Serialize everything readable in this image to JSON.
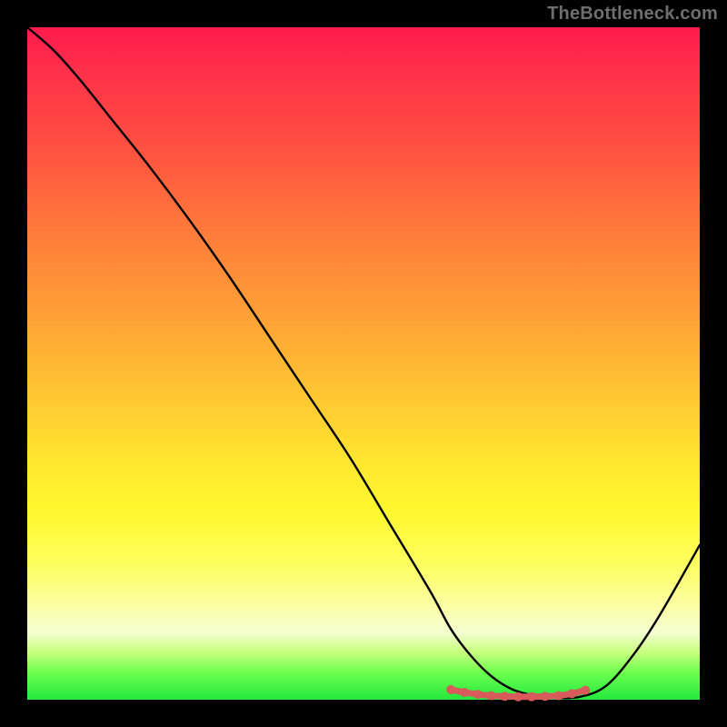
{
  "watermark": "TheBottleneck.com",
  "colors": {
    "frame": "#000000",
    "curve": "#000000",
    "marker_stroke": "#d85a5a",
    "marker_fill": "#d85a5a",
    "watermark": "#6e6e6e"
  },
  "chart_data": {
    "type": "line",
    "title": "",
    "xlabel": "",
    "ylabel": "",
    "xlim": [
      0,
      100
    ],
    "ylim": [
      0,
      100
    ],
    "grid": false,
    "legend": false,
    "series": [
      {
        "name": "bottleneck-curve",
        "x": [
          0,
          4,
          8,
          12,
          18,
          24,
          30,
          36,
          42,
          48,
          54,
          60,
          63,
          66,
          69,
          72,
          75,
          78,
          82,
          86,
          90,
          94,
          100
        ],
        "y": [
          100,
          96.5,
          92,
          87,
          79.5,
          71.5,
          63,
          54,
          45,
          36,
          26,
          16,
          10.5,
          6.5,
          3.5,
          1.6,
          0.7,
          0.3,
          0.4,
          2,
          6.5,
          12.5,
          23
        ]
      },
      {
        "name": "near-zero-markers",
        "x": [
          63,
          65,
          67,
          69,
          71,
          73,
          75,
          77,
          79,
          81,
          83
        ],
        "y": [
          1.5,
          1.1,
          0.8,
          0.6,
          0.5,
          0.45,
          0.45,
          0.5,
          0.6,
          0.9,
          1.4
        ]
      }
    ],
    "annotations": []
  }
}
